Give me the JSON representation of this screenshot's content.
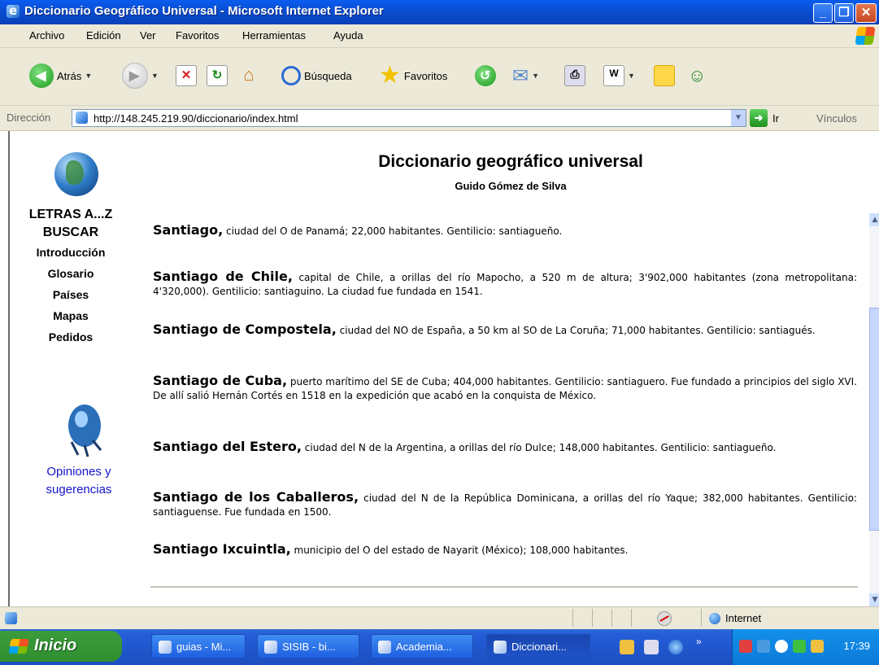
{
  "window": {
    "title": "Diccionario Geográfico Universal - Microsoft Internet Explorer",
    "buttons": {
      "minimize": "_",
      "maximize": "❐",
      "close": "✕"
    }
  },
  "menu": [
    "Archivo",
    "Edición",
    "Ver",
    "Favoritos",
    "Herramientas",
    "Ayuda"
  ],
  "toolbar": {
    "back": "Atrás",
    "search": "Búsqueda",
    "favorites": "Favoritos"
  },
  "address": {
    "label": "Dirección",
    "url": "http://148.245.219.90/diccionario/index.html",
    "go": "Ir",
    "links": "Vínculos"
  },
  "page": {
    "title": "Diccionario geográfico universal",
    "author": "Guido Gómez de Silva",
    "nav": [
      "LETRAS A...Z",
      "BUSCAR",
      "Introducción",
      "Glosario",
      "Países",
      "Mapas",
      "Pedidos"
    ],
    "opinions": [
      "Opiniones y",
      "sugerencias"
    ],
    "entries": [
      {
        "term": "Santiago,",
        "text": "ciudad del O de Panamá; 22,000 habitantes. Gentilicio: santiagueño."
      },
      {
        "term": "Santiago de Chile,",
        "text": "capital de Chile, a orillas del río Mapocho, a 520 m de altura; 3'902,000 habitantes (zona metropolitana: 4'320,000). Gentilicio: santiaguino. La ciudad fue fundada en 1541."
      },
      {
        "term": "Santiago de Compostela,",
        "text": "ciudad del NO de España, a 50 km al SO de La Coruña; 71,000 habitantes. Gentilicio: santiagués."
      },
      {
        "term": "Santiago de Cuba,",
        "text": "puerto marítimo del SE de Cuba; 404,000 habitantes. Gentilicio: santiaguero. Fue fundado a principios del siglo XVI. De allí salió Hernán Cortés en 1518 en la expedición que acabó en la conquista de México."
      },
      {
        "term": "Santiago del Estero,",
        "text": "ciudad del N de la Argentina, a orillas del río Dulce; 148,000 habitantes. Gentilicio: santiagueño."
      },
      {
        "term": "Santiago de los Caballeros,",
        "text": "ciudad del N de la República Dominicana, a orillas del río Yaque; 382,000 habitantes. Gentilicio: santiaguense. Fue fundada en 1500."
      },
      {
        "term": "Santiago Ixcuintla,",
        "text": "municipio del O del estado de Nayarit (México); 108,000 habitantes."
      }
    ]
  },
  "status": {
    "zone": "Internet"
  },
  "taskbar": {
    "start": "Inicio",
    "tasks": [
      "guias - Mi...",
      "SISIB - bi...",
      "Academia...",
      "Diccionari..."
    ],
    "clock": "17:39"
  }
}
